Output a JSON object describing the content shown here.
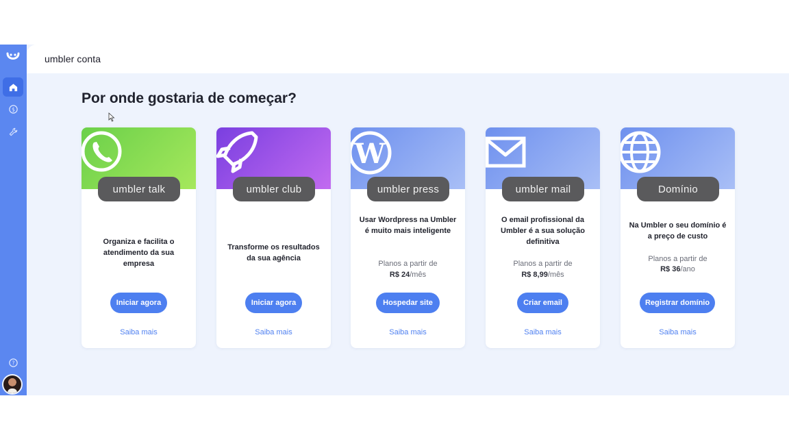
{
  "app": {
    "brand": "umbler conta"
  },
  "sidebar": {
    "items": [
      {
        "name": "home",
        "icon": "home-icon"
      },
      {
        "name": "billing",
        "icon": "dollar-coin-icon"
      },
      {
        "name": "tools",
        "icon": "wrench-icon"
      },
      {
        "name": "help",
        "icon": "help-circle-icon"
      }
    ]
  },
  "page": {
    "title": "Por onde gostaria de começar?"
  },
  "cards": [
    {
      "product": "umbler talk",
      "icon": "whatsapp-icon",
      "description": "Organiza e facilita o atendimento da sua empresa",
      "price_label": "",
      "price_value": "",
      "price_unit": "",
      "cta": "Iniciar agora",
      "more": "Saiba mais"
    },
    {
      "product": "umbler club",
      "icon": "rocket-icon",
      "description": "Transforme os resultados da sua agência",
      "price_label": "",
      "price_value": "",
      "price_unit": "",
      "cta": "Iniciar agora",
      "more": "Saiba mais"
    },
    {
      "product": "umbler press",
      "icon": "wordpress-icon",
      "description": "Usar Wordpress na Umbler é muito mais inteligente",
      "price_label": "Planos a partir de",
      "price_value": "R$ 24",
      "price_unit": "/mês",
      "cta": "Hospedar site",
      "more": "Saiba mais"
    },
    {
      "product": "umbler mail",
      "icon": "envelope-icon",
      "description": "O email profissional da Umbler é a sua solução definitiva",
      "price_label": "Planos a partir de",
      "price_value": "R$ 8,99",
      "price_unit": "/mês",
      "cta": "Criar email",
      "more": "Saiba mais"
    },
    {
      "product": "Domínio",
      "icon": "globe-icon",
      "description": "Na Umbler o seu domínio é a preço de custo",
      "price_label": "Planos a partir de",
      "price_value": "R$ 36",
      "price_unit": "/ano",
      "cta": "Registrar domínio",
      "more": "Saiba mais"
    }
  ],
  "colors": {
    "accent": "#4d7ff0",
    "sidebar": "#5b87f0",
    "pill": "#5a5a5c",
    "background": "#eef3fd"
  }
}
